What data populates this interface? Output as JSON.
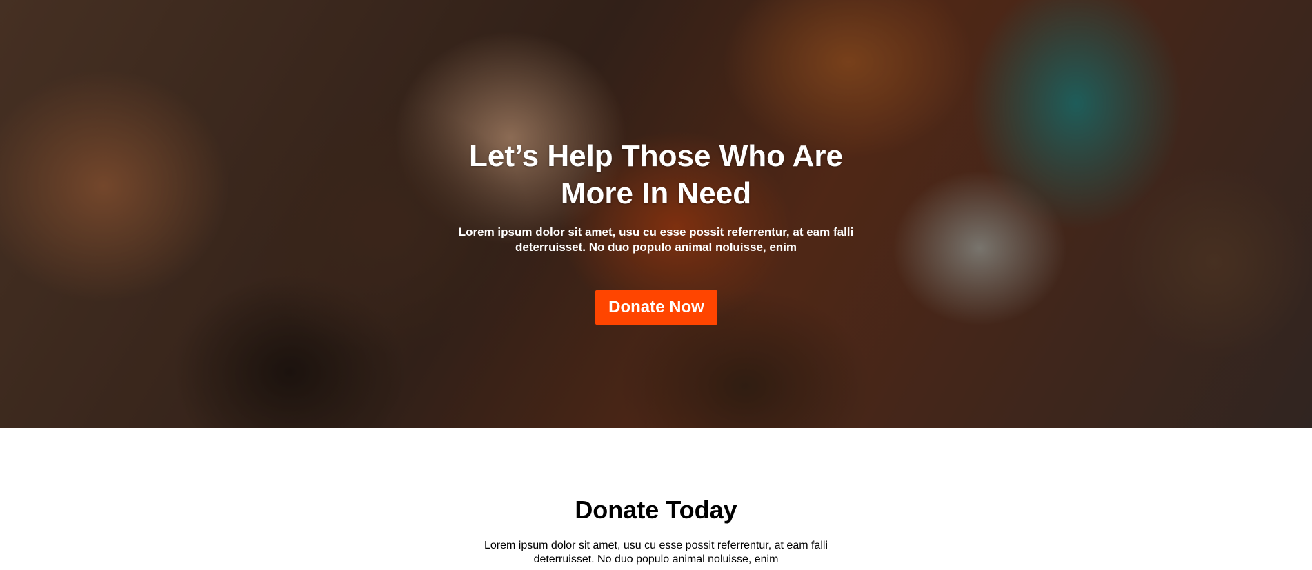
{
  "hero": {
    "title": "Let’s Help Those Who Are More In Need",
    "subtitle": "Lorem ipsum dolor sit amet, usu cu esse possit referrentur, at eam falli deterruisset. No duo populo animal noluisse, enim",
    "button_label": "Donate Now",
    "button_color": "#ff4500"
  },
  "donate_section": {
    "title": "Donate Today",
    "text": "Lorem ipsum dolor sit amet, usu cu esse possit referrentur, at eam falli deterruisset. No duo populo animal noluisse, enim"
  }
}
